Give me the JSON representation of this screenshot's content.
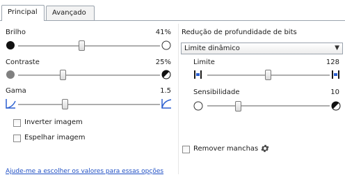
{
  "tabs": [
    {
      "label": "Principal",
      "active": true
    },
    {
      "label": "Avançado",
      "active": false
    }
  ],
  "left": {
    "brightness": {
      "label": "Brilho",
      "value": "41%",
      "level": 0.41
    },
    "contrast": {
      "label": "Contraste",
      "value": "25%",
      "level": 0.25
    },
    "gamma": {
      "label": "Gama",
      "value": "1.5",
      "level": 0.3
    },
    "invert": {
      "label": "Inverter imagem",
      "checked": false
    },
    "mirror": {
      "label": "Espelhar imagem",
      "checked": false
    }
  },
  "right": {
    "bit_depth_label": "Redução de profundidade de bits",
    "bit_depth_value": "Limite dinâmico",
    "threshold": {
      "label": "Limite",
      "value": "128",
      "level": 0.5
    },
    "sensitivity": {
      "label": "Sensibilidade",
      "value": "10",
      "level": 0.2
    },
    "remove_spots": {
      "label": "Remover manchas",
      "checked": false
    }
  },
  "help_link": "Ajude-me a escolher os valores para essas opções",
  "colors": {
    "link": "#1f4fc4",
    "border": "#9aa3ad",
    "gamma_icon": "#2b5fd0"
  }
}
